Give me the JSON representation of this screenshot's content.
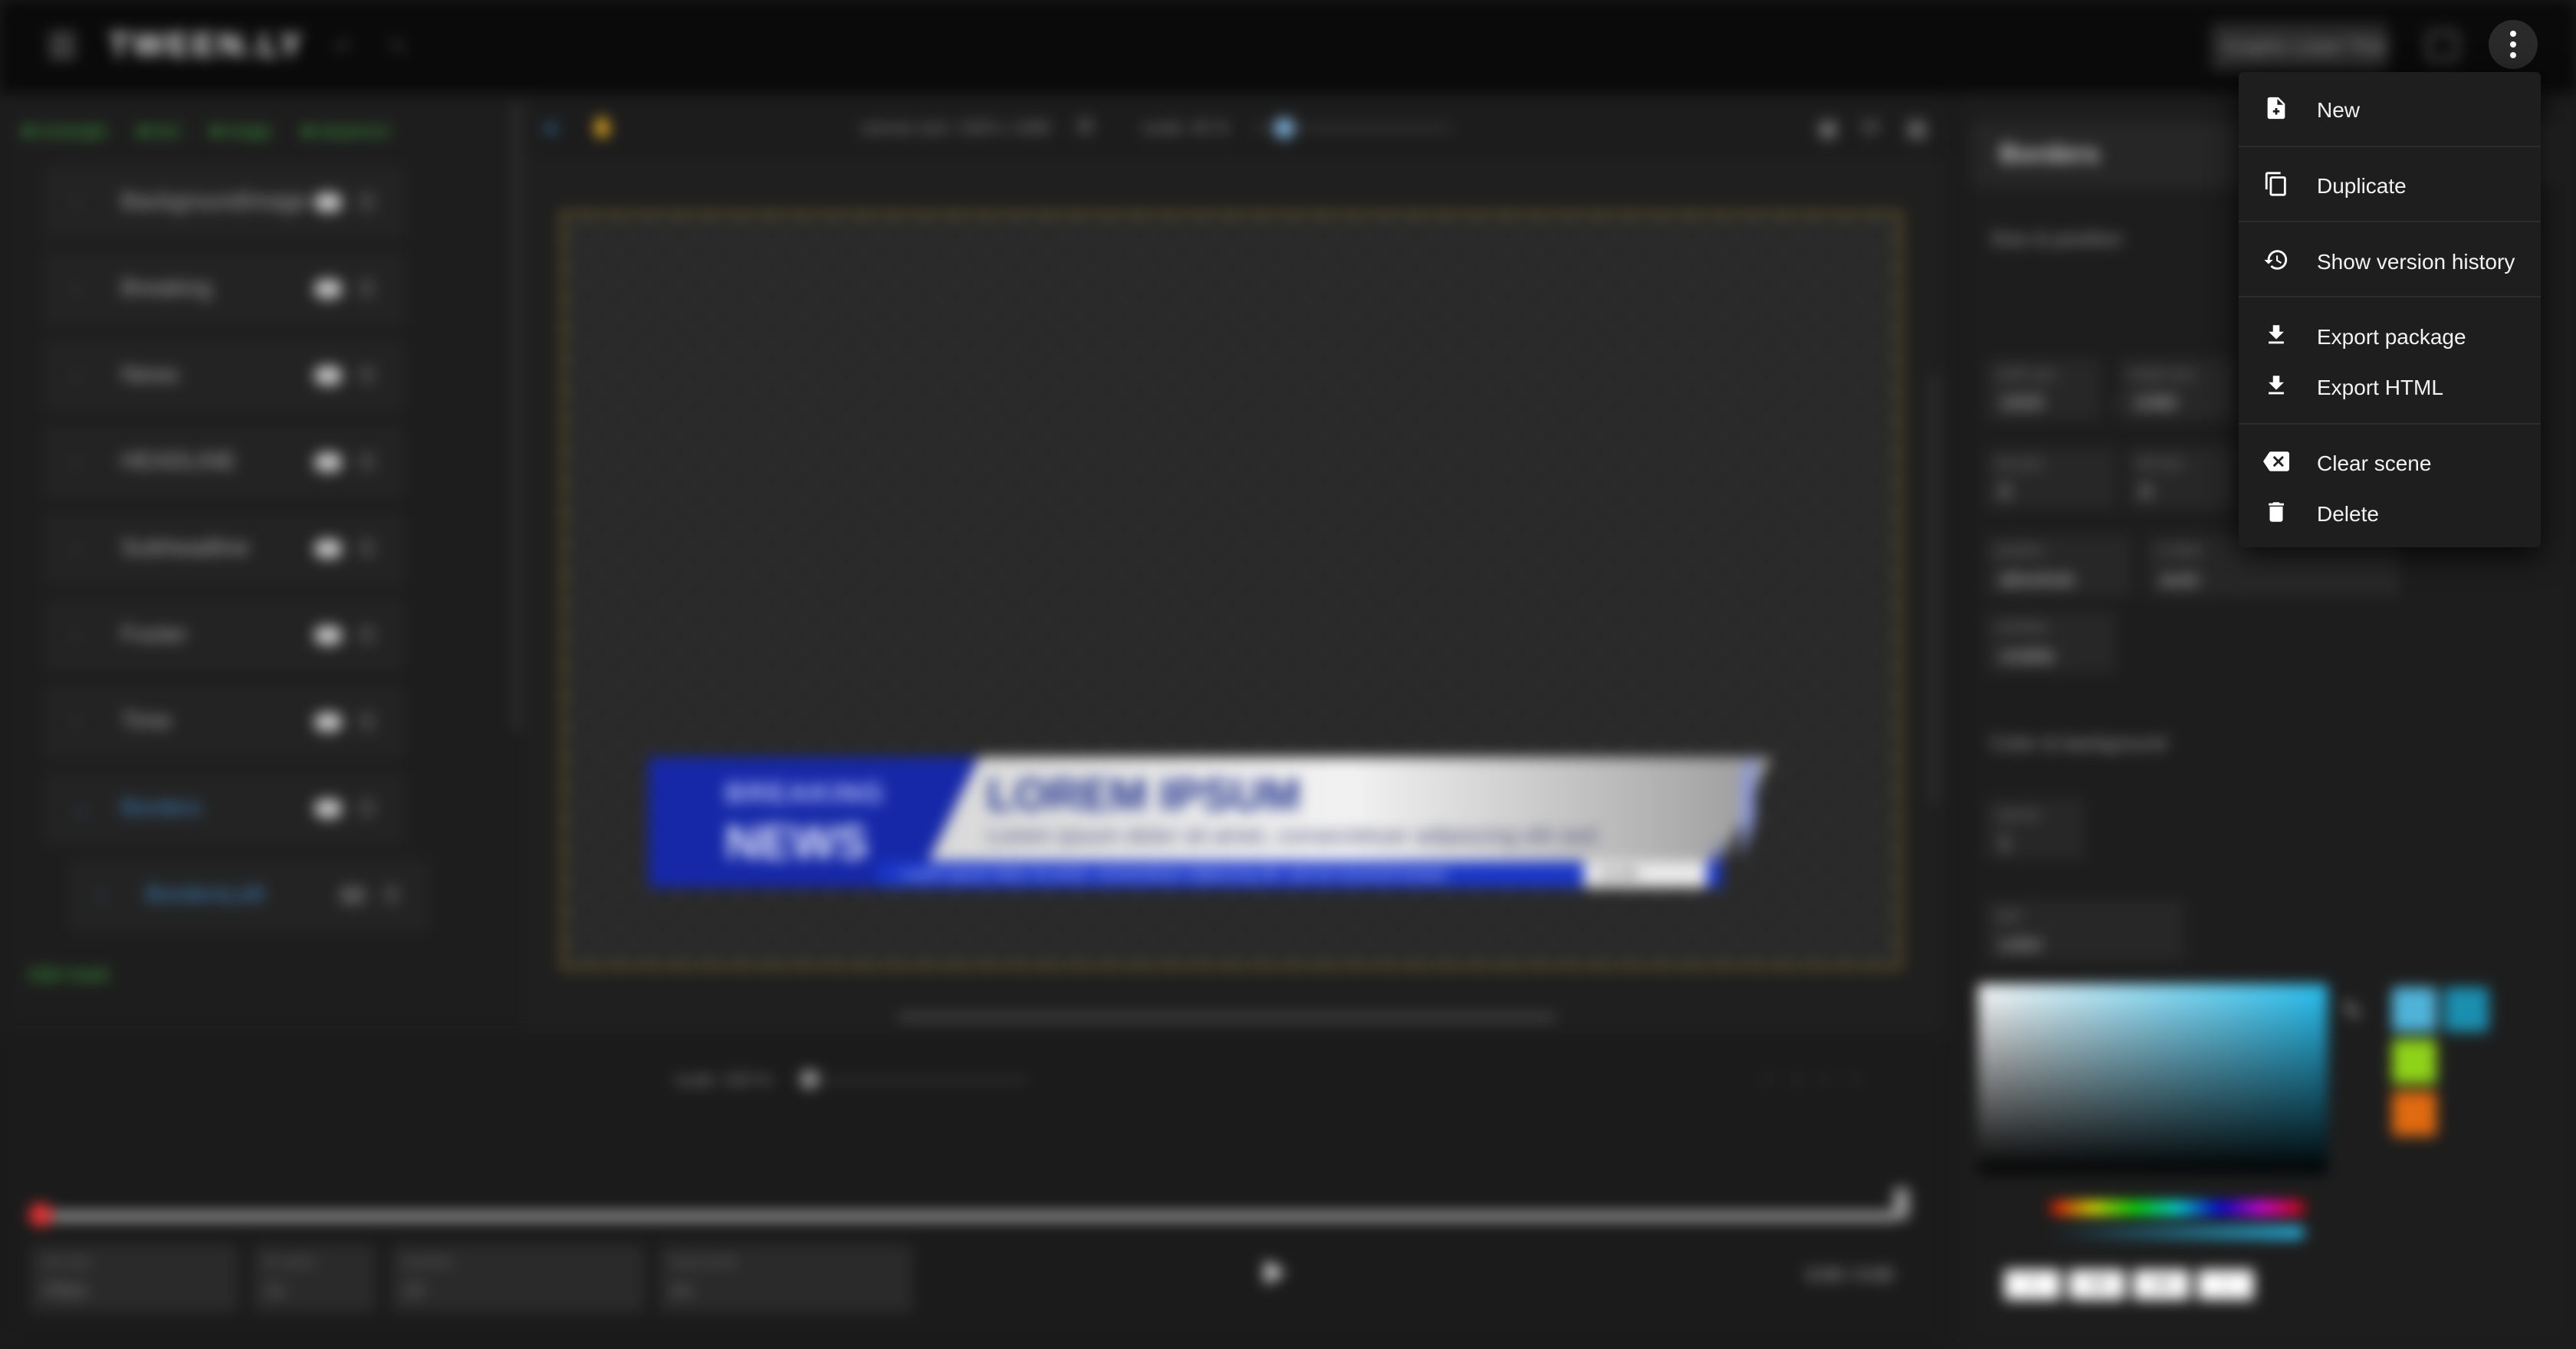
{
  "app": {
    "logo": "TWEEN.LY",
    "scene_name": "Graphic Lower Third",
    "undo_icon": "undo-icon",
    "redo_icon": "redo-icon"
  },
  "menu": {
    "items": [
      {
        "label": "New",
        "icon": "file-plus-icon"
      },
      {
        "label": "Duplicate",
        "icon": "copy-icon"
      },
      {
        "label": "Show version history",
        "icon": "history-icon"
      },
      {
        "label": "Export package",
        "icon": "download-icon"
      },
      {
        "label": "Export HTML",
        "icon": "download-icon"
      },
      {
        "label": "Clear scene",
        "icon": "backspace-x-icon"
      },
      {
        "label": "Delete",
        "icon": "trash-icon"
      }
    ]
  },
  "layers": {
    "tools": [
      "rectangle",
      "text",
      "image",
      "sequence"
    ],
    "items": [
      {
        "name": "BackgroundImage"
      },
      {
        "name": "Breaking"
      },
      {
        "name": "News"
      },
      {
        "name": "HEADLINE"
      },
      {
        "name": "Subheadline"
      },
      {
        "name": "Footer"
      },
      {
        "name": "Time"
      },
      {
        "name": "Borders"
      },
      {
        "name": "BordersLeft"
      }
    ],
    "add_mask": "Add mask"
  },
  "canvas": {
    "size_label": "canvas size: 1920 x 1080",
    "scale_label": "scale: 40 %",
    "scale_value": 0.12,
    "graphic": {
      "breaking": "BREAKING",
      "news": "NEWS",
      "headline": "LOREM IPSUM",
      "subheadline": "Lorem ipsum dolor sit amet, consectetuer adipiscing elit sed",
      "ticker": "Lorem ipsum dolor sit amet, consectetuer adipiscing elit, sed do eiusmod tempor",
      "time": "12:00"
    }
  },
  "properties": {
    "header": "Borders",
    "size_section": "Size & position",
    "width_label": "width (px)",
    "width_value": "1920",
    "height_label": "height (px)",
    "height_value": "1080",
    "top_label": "top (px)",
    "top_value": "0",
    "left_label": "left (px)",
    "left_value": "0",
    "position_label": "position",
    "position_value": "absolute",
    "zindex_label": "z-index",
    "zindex_value": "auto",
    "overflow_label": "overflow",
    "overflow_value": "visible",
    "color_section": "Color & background",
    "opacity_label": "opacity",
    "opacity_value": "1",
    "type_label": "type",
    "type_value": "color",
    "rgba": [
      "0",
      "195",
      "245",
      "1"
    ],
    "swatch_colors": [
      "#4fb3d9",
      "#1b8fb0",
      "#8fd21a",
      "#e06a10"
    ]
  },
  "timeline": {
    "zoom_label": "scale: 100 %",
    "fields": [
      {
        "label": "set-rate",
        "value": "30fps"
      },
      {
        "label": "fix-sped",
        "value": "1x"
      },
      {
        "label": "duration",
        "value": "10"
      },
      {
        "label": "loop-count",
        "value": "no"
      }
    ],
    "time": "0:00 / 0:00"
  }
}
